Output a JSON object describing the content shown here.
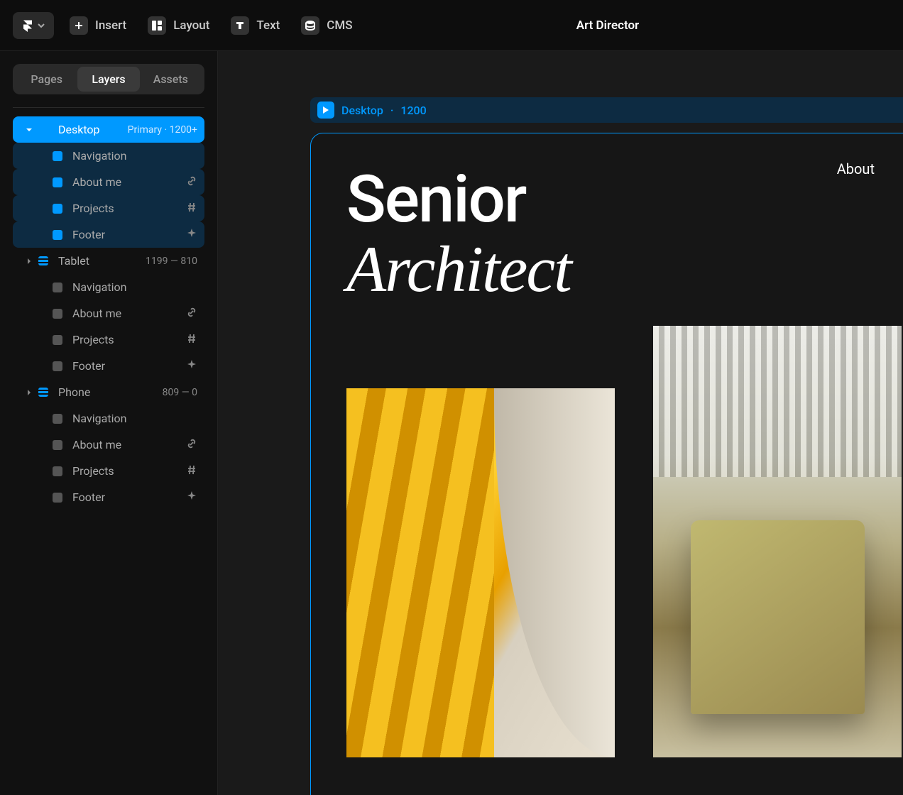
{
  "toolbar": {
    "insert": "Insert",
    "layout": "Layout",
    "text": "Text",
    "cms": "CMS",
    "docTitle": "Art Director"
  },
  "sidebar": {
    "tabs": {
      "pages": "Pages",
      "layers": "Layers",
      "assets": "Assets"
    },
    "breakpoints": [
      {
        "name": "Desktop",
        "meta": "Primary · 1200+",
        "selected": true,
        "children": [
          {
            "name": "Navigation",
            "trail": ""
          },
          {
            "name": "About me",
            "trail": "link"
          },
          {
            "name": "Projects",
            "trail": "hash"
          },
          {
            "name": "Footer",
            "trail": "sparkle"
          }
        ]
      },
      {
        "name": "Tablet",
        "meta": "1199 — 810",
        "selected": false,
        "children": [
          {
            "name": "Navigation",
            "trail": ""
          },
          {
            "name": "About me",
            "trail": "link"
          },
          {
            "name": "Projects",
            "trail": "hash"
          },
          {
            "name": "Footer",
            "trail": "sparkle"
          }
        ]
      },
      {
        "name": "Phone",
        "meta": "809 — 0",
        "selected": false,
        "children": [
          {
            "name": "Navigation",
            "trail": ""
          },
          {
            "name": "About me",
            "trail": "link"
          },
          {
            "name": "Projects",
            "trail": "hash"
          },
          {
            "name": "Footer",
            "trail": "sparkle"
          }
        ]
      }
    ]
  },
  "canvas": {
    "breakpointLabel": "Desktop",
    "breakpointWidth": "1200",
    "navLink": "About",
    "heroLine1": "Senior",
    "heroLine2": "Architect"
  }
}
